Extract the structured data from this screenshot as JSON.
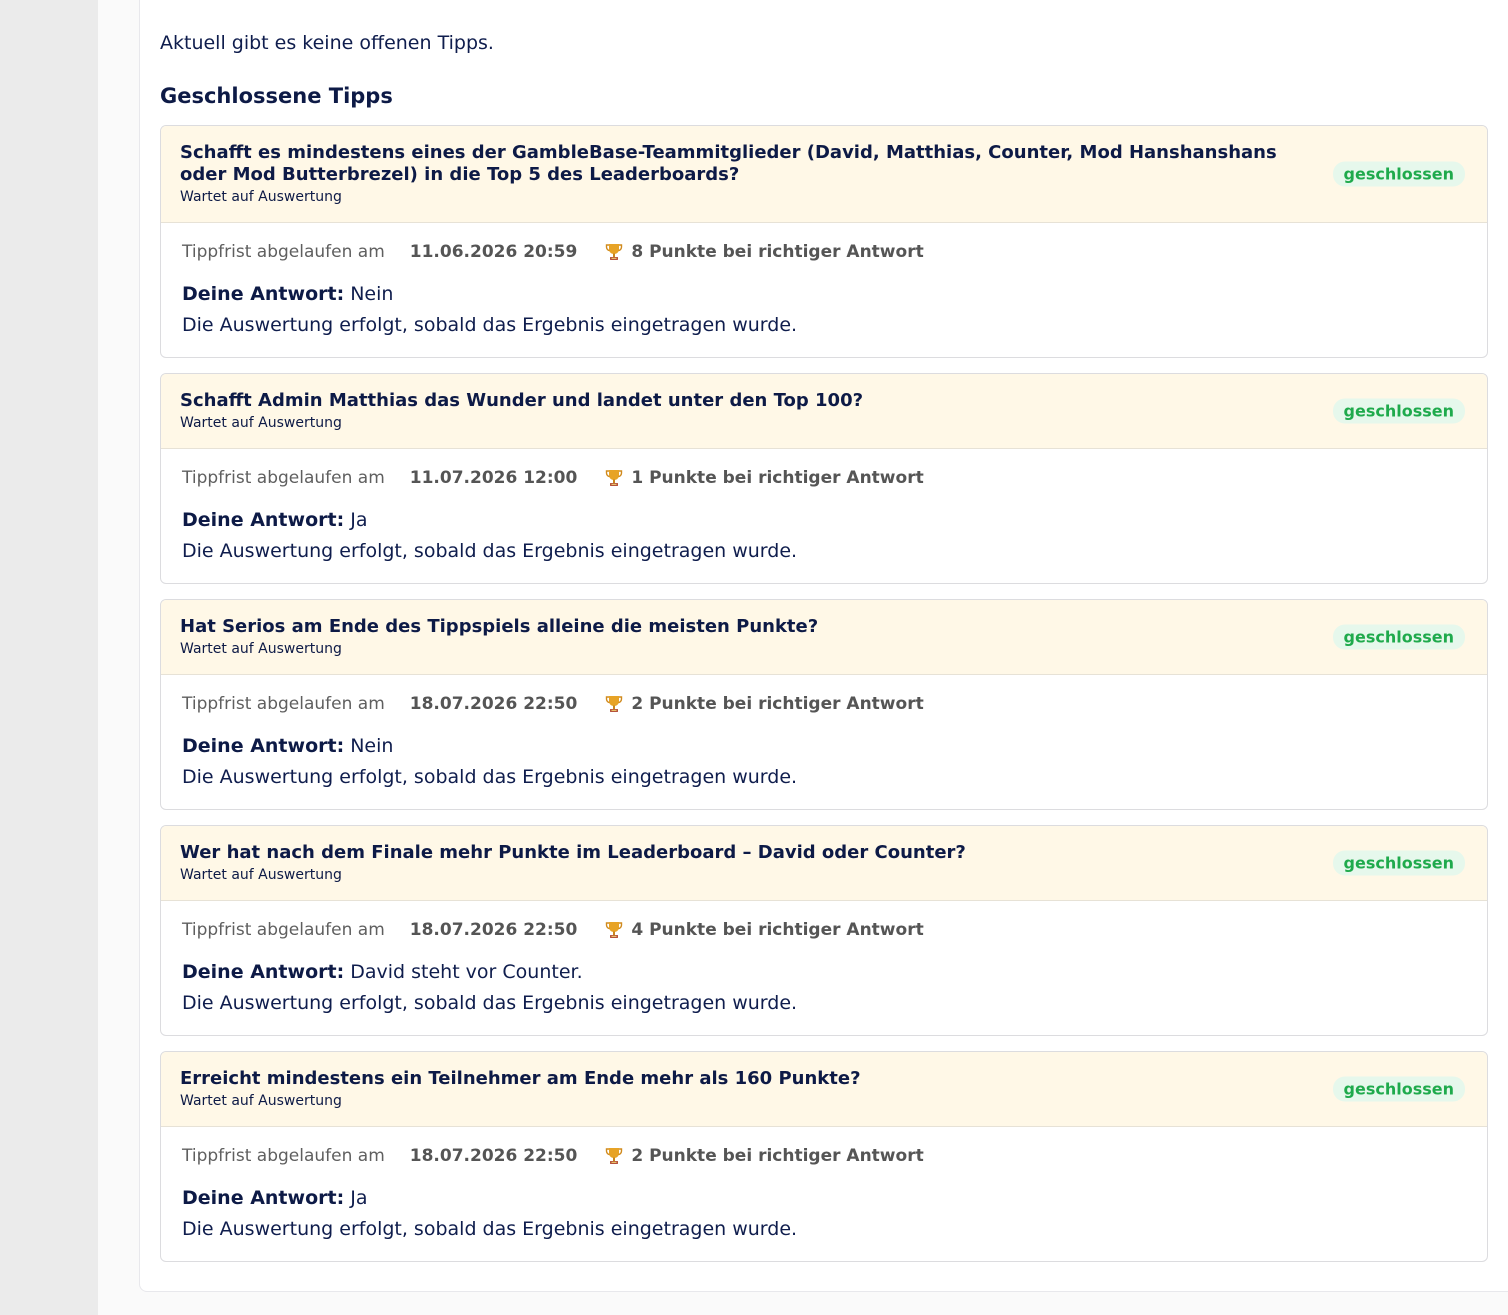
{
  "open_tips": {
    "empty_text": "Aktuell gibt es keine offenen Tipps."
  },
  "closed_tips": {
    "heading": "Geschlossene Tipps",
    "items": [
      {
        "question": "Schafft es mindestens eines der GambleBase-Teammitglieder (David, Matthias, Counter, Mod Hanshanshans oder Mod Butterbrezel) in die Top 5 des Leaderboards?",
        "status_note": "Wartet auf Auswertung",
        "badge": "geschlossen",
        "deadline_label": "Tippfrist abgelaufen am",
        "deadline": "11.06.2026 20:59",
        "points_text": "8 Punkte bei richtiger Antwort",
        "answer_label": "Deine Antwort:",
        "answer": "Nein",
        "result_note": "Die Auswertung erfolgt, sobald das Ergebnis eingetragen wurde."
      },
      {
        "question": "Schafft Admin Matthias das Wunder und landet unter den Top 100?",
        "status_note": "Wartet auf Auswertung",
        "badge": "geschlossen",
        "deadline_label": "Tippfrist abgelaufen am",
        "deadline": "11.07.2026 12:00",
        "points_text": "1 Punkte bei richtiger Antwort",
        "answer_label": "Deine Antwort:",
        "answer": "Ja",
        "result_note": "Die Auswertung erfolgt, sobald das Ergebnis eingetragen wurde."
      },
      {
        "question": "Hat Serios am Ende des Tippspiels alleine die meisten Punkte?",
        "status_note": "Wartet auf Auswertung",
        "badge": "geschlossen",
        "deadline_label": "Tippfrist abgelaufen am",
        "deadline": "18.07.2026 22:50",
        "points_text": "2 Punkte bei richtiger Antwort",
        "answer_label": "Deine Antwort:",
        "answer": "Nein",
        "result_note": "Die Auswertung erfolgt, sobald das Ergebnis eingetragen wurde."
      },
      {
        "question": "Wer hat nach dem Finale mehr Punkte im Leaderboard – David oder Counter?",
        "status_note": "Wartet auf Auswertung",
        "badge": "geschlossen",
        "deadline_label": "Tippfrist abgelaufen am",
        "deadline": "18.07.2026 22:50",
        "points_text": "4 Punkte bei richtiger Antwort",
        "answer_label": "Deine Antwort:",
        "answer": "David steht vor Counter.",
        "result_note": "Die Auswertung erfolgt, sobald das Ergebnis eingetragen wurde."
      },
      {
        "question": "Erreicht mindestens ein Teilnehmer am Ende mehr als 160 Punkte?",
        "status_note": "Wartet auf Auswertung",
        "badge": "geschlossen",
        "deadline_label": "Tippfrist abgelaufen am",
        "deadline": "18.07.2026 22:50",
        "points_text": "2 Punkte bei richtiger Antwort",
        "answer_label": "Deine Antwort:",
        "answer": "Ja",
        "result_note": "Die Auswertung erfolgt, sobald das Ergebnis eingetragen wurde."
      }
    ]
  },
  "icons": {
    "points": "trophy-icon"
  },
  "colors": {
    "card_header_bg": "#fff8e7",
    "badge_bg": "#e6f8ec",
    "badge_text": "#1faa4c",
    "heading_text": "#0d1a46"
  }
}
